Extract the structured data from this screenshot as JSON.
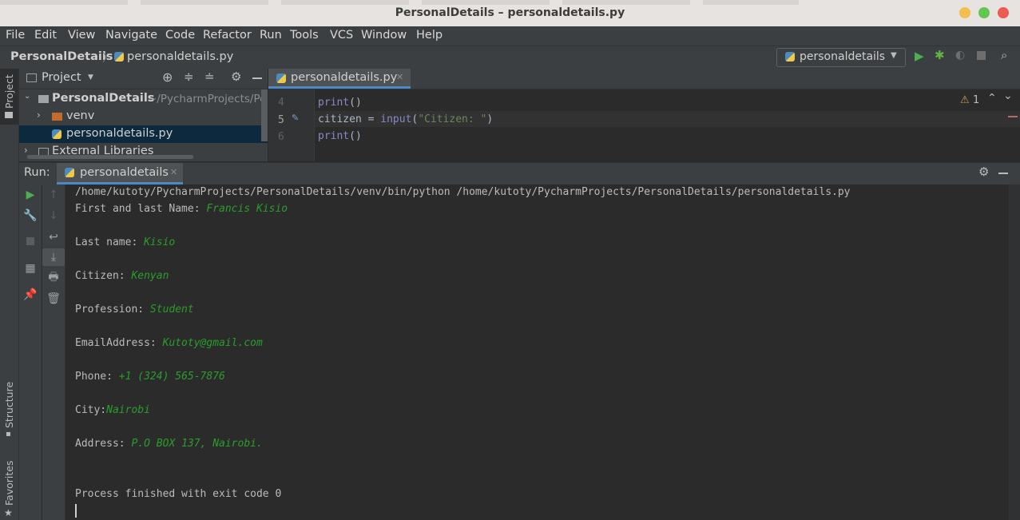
{
  "window": {
    "title": "PersonalDetails – personaldetails.py"
  },
  "menu": [
    "File",
    "Edit",
    "View",
    "Navigate",
    "Code",
    "Refactor",
    "Run",
    "Tools",
    "VCS",
    "Window",
    "Help"
  ],
  "breadcrumb": {
    "project": "PersonalDetails",
    "file": "personaldetails.py"
  },
  "run_config": {
    "label": "personaldetails"
  },
  "side_tabs": {
    "project": "Project",
    "structure": "Structure",
    "favorites": "Favorites"
  },
  "project_panel": {
    "title": "Project",
    "root_name": "PersonalDetails",
    "root_path": "~/PycharmProjects/Pe",
    "items": [
      "venv",
      "personaldetails.py",
      "External Libraries"
    ]
  },
  "editor": {
    "tab": "personaldetails.py",
    "warning_count": "1",
    "lines": [
      {
        "num": "4",
        "tokens": [
          {
            "t": "print",
            "c": "#8888c6"
          },
          {
            "t": "()",
            "c": "#a9b7c6"
          }
        ]
      },
      {
        "num": "5",
        "tokens": [
          {
            "t": "citizen = ",
            "c": "#a9b7c6"
          },
          {
            "t": "input",
            "c": "#8888c6"
          },
          {
            "t": "(",
            "c": "#a9b7c6"
          },
          {
            "t": "\"Citizen: \"",
            "c": "#6a8759"
          },
          {
            "t": ")",
            "c": "#a9b7c6"
          }
        ]
      },
      {
        "num": "6",
        "tokens": [
          {
            "t": "print",
            "c": "#8888c6"
          },
          {
            "t": "()",
            "c": "#a9b7c6"
          }
        ]
      }
    ]
  },
  "run_panel": {
    "label": "Run:",
    "tab": "personaldetails",
    "command": "/home/kutoty/PycharmProjects/PersonalDetails/venv/bin/python /home/kutoty/PycharmProjects/PersonalDetails/personaldetails.py",
    "outputs": [
      {
        "prompt": "First and last Name: ",
        "value": "Francis Kisio"
      },
      {
        "prompt": "Last name: ",
        "value": "Kisio"
      },
      {
        "prompt": "Citizen: ",
        "value": "Kenyan"
      },
      {
        "prompt": "Profession: ",
        "value": "Student"
      },
      {
        "prompt": "EmailAddress: ",
        "value": "Kutoty@gmail.com"
      },
      {
        "prompt": "Phone: ",
        "value": "+1 (324) 565-7876"
      },
      {
        "prompt": "City:",
        "value": "Nairobi"
      },
      {
        "prompt": "Address: ",
        "value": "P.O BOX 137, Nairobi."
      }
    ],
    "finish": "Process finished with exit code 0"
  },
  "colors": {
    "accent_green": "#2a9e2a",
    "selection": "#0d293e",
    "tab_underline": "#4a88c7"
  }
}
